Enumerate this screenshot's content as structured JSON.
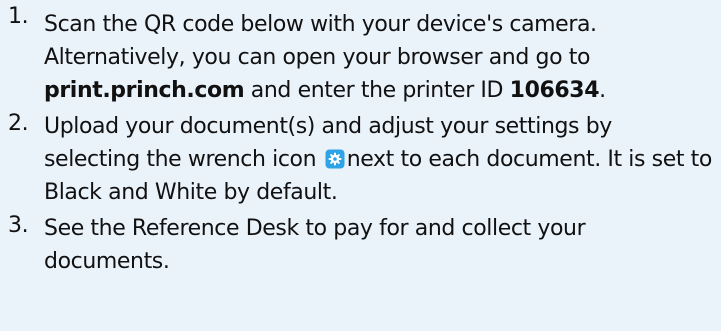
{
  "instructions": {
    "steps": [
      {
        "number": "1.",
        "text_a": "Scan the QR code below with your device's camera. Alternatively, you can open your browser and go to ",
        "url": "print.princh.com",
        "text_b": " and enter the printer ID ",
        "printer_id": "106634",
        "text_c": "."
      },
      {
        "number": "2.",
        "text_a": "Upload your document(s) and adjust your settings by selecting the wrench icon ",
        "icon": "wrench-settings-icon",
        "text_b": "next to each document.  It is set to Black and White by default."
      },
      {
        "number": "3.",
        "text_a": "See the Reference Desk to pay for and collect your documents."
      }
    ]
  },
  "colors": {
    "panel_background": "#eaf2fa",
    "text": "#111111",
    "icon_fill": "#2ea3e6",
    "icon_glyph": "#ffffff"
  }
}
